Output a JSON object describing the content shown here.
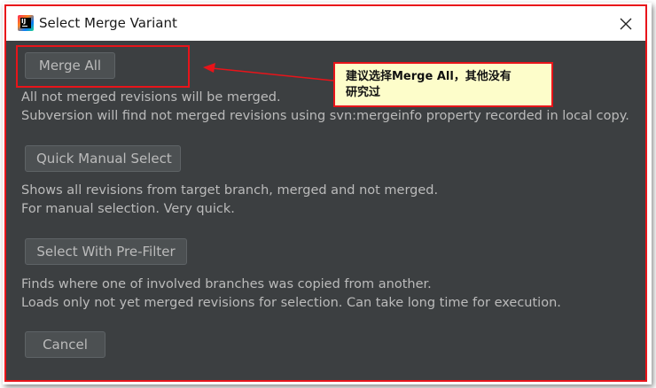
{
  "window": {
    "title": "Select Merge Variant",
    "close_glyph": "✕"
  },
  "options": [
    {
      "button_label": "Merge All",
      "lines": [
        "All not merged revisions will be merged.",
        "Subversion will find not merged revisions using svn:mergeinfo property recorded in local copy."
      ]
    },
    {
      "button_label": "Quick Manual Select",
      "lines": [
        "Shows all revisions from target branch, merged and not merged.",
        "For manual selection. Very quick."
      ]
    },
    {
      "button_label": "Select With Pre-Filter",
      "lines": [
        "Finds where one of involved branches was copied from another.",
        "Loads only not yet merged revisions for selection. Can take long time for execution."
      ]
    }
  ],
  "cancel_label": "Cancel",
  "annotation": {
    "callout_line1": "建议选择Merge All，其他没有",
    "callout_line2": "研究过"
  },
  "colors": {
    "annotation_red": "#e8141a",
    "dialog_background": "#3c3f41",
    "callout_background": "#fdfdca",
    "text": "#bbbbbb"
  },
  "icons": {
    "app": "intellij-idea-icon",
    "close": "close-icon"
  }
}
